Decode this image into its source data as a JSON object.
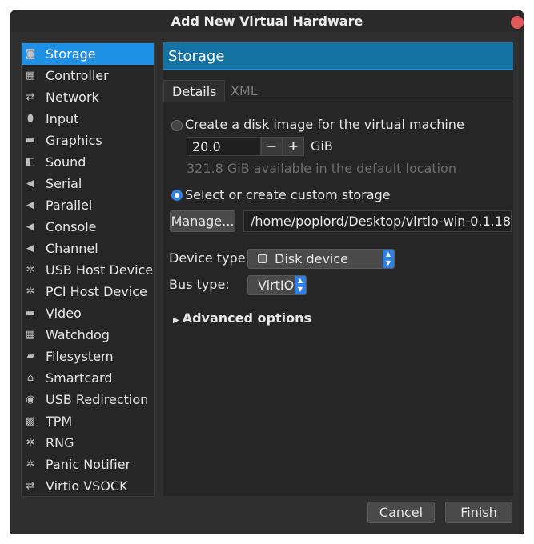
{
  "window": {
    "title": "Add New Virtual Hardware"
  },
  "sidebar": {
    "items": [
      {
        "label": "Storage",
        "icon": "storage-icon",
        "glyph": "◙"
      },
      {
        "label": "Controller",
        "icon": "controller-icon",
        "glyph": "▦"
      },
      {
        "label": "Network",
        "icon": "network-icon",
        "glyph": "⇄"
      },
      {
        "label": "Input",
        "icon": "mouse-icon",
        "glyph": "⬮"
      },
      {
        "label": "Graphics",
        "icon": "monitor-icon",
        "glyph": "▬"
      },
      {
        "label": "Sound",
        "icon": "speaker-icon",
        "glyph": "◧"
      },
      {
        "label": "Serial",
        "icon": "serial-icon",
        "glyph": "◀"
      },
      {
        "label": "Parallel",
        "icon": "parallel-icon",
        "glyph": "◀"
      },
      {
        "label": "Console",
        "icon": "console-icon",
        "glyph": "◀"
      },
      {
        "label": "Channel",
        "icon": "channel-icon",
        "glyph": "◀"
      },
      {
        "label": "USB Host Device",
        "icon": "usb-host-icon",
        "glyph": "✲"
      },
      {
        "label": "PCI Host Device",
        "icon": "pci-host-icon",
        "glyph": "✲"
      },
      {
        "label": "Video",
        "icon": "video-icon",
        "glyph": "▬"
      },
      {
        "label": "Watchdog",
        "icon": "watchdog-icon",
        "glyph": "▦"
      },
      {
        "label": "Filesystem",
        "icon": "folder-icon",
        "glyph": "▰"
      },
      {
        "label": "Smartcard",
        "icon": "smartcard-icon",
        "glyph": "⌂"
      },
      {
        "label": "USB Redirection",
        "icon": "usb-redirection-icon",
        "glyph": "◉"
      },
      {
        "label": "TPM",
        "icon": "tpm-icon",
        "glyph": "▩"
      },
      {
        "label": "RNG",
        "icon": "rng-icon",
        "glyph": "✲"
      },
      {
        "label": "Panic Notifier",
        "icon": "panic-icon",
        "glyph": "✲"
      },
      {
        "label": "Virtio VSOCK",
        "icon": "vsock-icon",
        "glyph": "⇄"
      }
    ],
    "selected_index": 0
  },
  "content": {
    "header": "Storage",
    "tabs": [
      {
        "label": "Details"
      },
      {
        "label": "XML"
      }
    ],
    "create_disk_label": "Create a disk image for the virtual machine",
    "size_value": "20.0",
    "size_unit": "GiB",
    "available_text": "321.8 GiB available in the default location",
    "custom_storage_label": "Select or create custom storage",
    "manage_button": "Manage...",
    "storage_path": "/home/poplord/Desktop/virtio-win-0.1.18",
    "device_type_label": "Device type:",
    "device_type_value": "Disk device",
    "bus_type_label": "Bus type:",
    "bus_type_value": "VirtIO",
    "advanced_options": "Advanced options"
  },
  "footer": {
    "cancel": "Cancel",
    "finish": "Finish"
  },
  "colors": {
    "accent": "#1e90e6",
    "header": "#1572a5",
    "close": "#e05a5a"
  }
}
